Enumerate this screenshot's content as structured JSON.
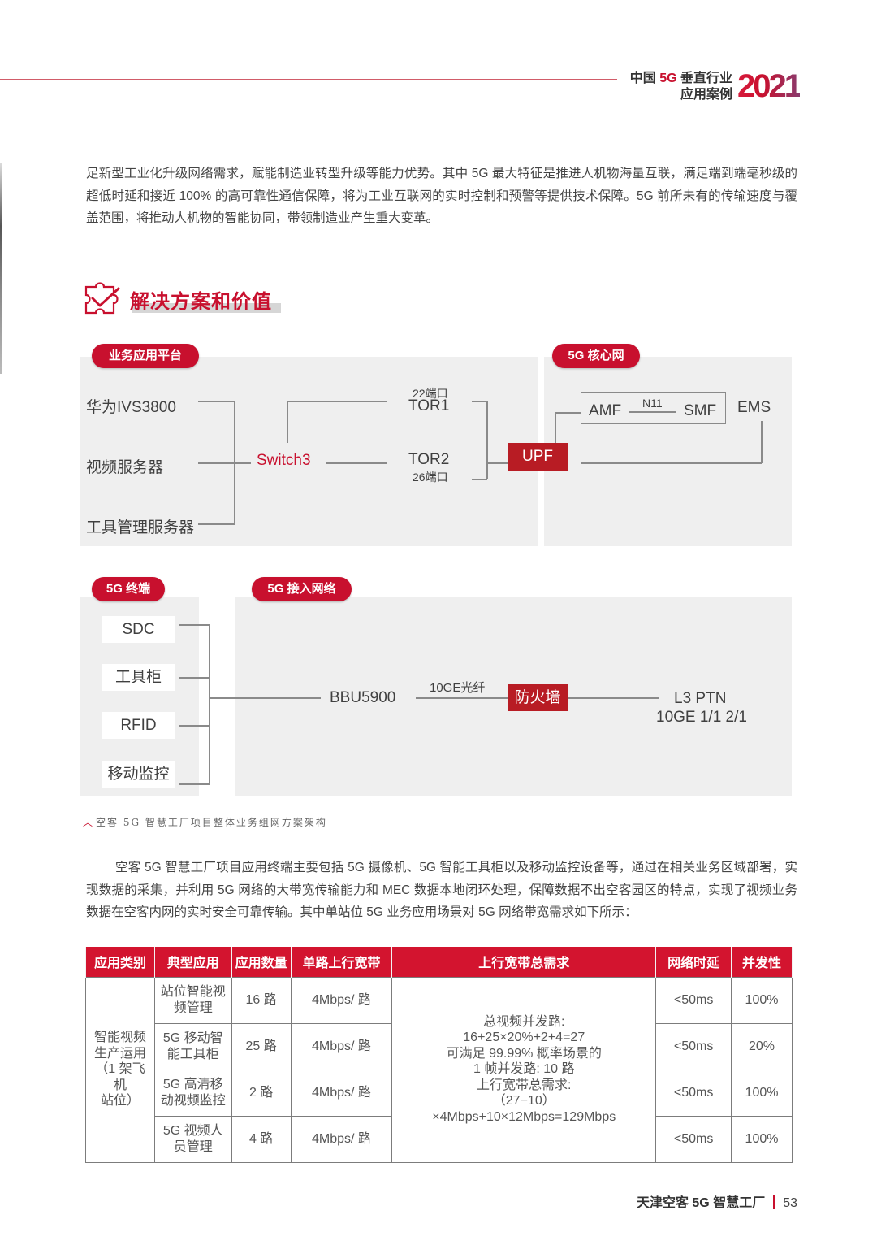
{
  "header": {
    "title_line1_prefix": "中国 ",
    "title_line1_accent": "5G",
    "title_line1_suffix": " 垂直行业",
    "title_line2": "应用案例",
    "year": "2021"
  },
  "intro_paragraph": "足新型工业化升级网络需求，赋能制造业转型升级等能力优势。其中 5G 最大特征是推进人机物海量互联，满足端到端毫秒级的超低时延和接近 100% 的高可靠性通信保障，将为工业互联网的实时控制和预警等提供技术保障。5G 前所未有的传输速度与覆盖范围，将推动人机物的智能协同，带领制造业产生重大变革。",
  "section": {
    "icon": "puzzle-check-icon",
    "title": "解决方案和价值"
  },
  "diagram": {
    "business_platform": {
      "label": "业务应用平台",
      "servers": [
        "华为IVS3800",
        "视频服务器",
        "工具管理服务器"
      ],
      "switch": "Switch3",
      "tor1": {
        "port": "22端口",
        "name": "TOR1"
      },
      "tor2": {
        "port": "26端口",
        "name": "TOR2"
      }
    },
    "core_network": {
      "label": "5G 核心网",
      "upf": "UPF",
      "amf": "AMF",
      "n11": "N11",
      "smf": "SMF",
      "ems": "EMS"
    },
    "terminals": {
      "label": "5G 终端",
      "items": [
        "SDC",
        "工具柜",
        "RFID",
        "移动监控"
      ]
    },
    "access_network": {
      "label": "5G 接入网络",
      "bbu": "BBU5900",
      "link_label": "10GE光纤",
      "firewall": "防火墙",
      "ptn_line1": "L3 PTN",
      "ptn_line2": "10GE 1/1 2/1"
    }
  },
  "caption": {
    "icon": "chevron-up-icon",
    "text": "空客 5G 智慧工厂项目整体业务组网方案架构"
  },
  "body_paragraph": "空客 5G 智慧工厂项目应用终端主要包括 5G 摄像机、5G 智能工具柜以及移动监控设备等，通过在相关业务区域部署，实现数据的采集，并利用 5G 网络的大带宽传输能力和 MEC 数据本地闭环处理，保障数据不出空客园区的特点，实现了视频业务数据在空客内网的实时安全可靠传输。其中单站位 5G 业务应用场景对 5G 网络带宽需求如下所示：",
  "table": {
    "headers": [
      "应用类别",
      "典型应用",
      "应用数量",
      "单路上行宽带",
      "上行宽带总需求",
      "网络时延",
      "并发性"
    ],
    "category": [
      "智能视频",
      "生产运用",
      "（1 架飞机",
      "站位）"
    ],
    "rows": [
      {
        "app": [
          "站位智能视",
          "频管理"
        ],
        "count": "16 路",
        "bandwidth": "4Mbps/ 路",
        "latency": "<50ms",
        "concurrency": "100%"
      },
      {
        "app": [
          "5G 移动智",
          "能工具柜"
        ],
        "count": "25 路",
        "bandwidth": "4Mbps/ 路",
        "latency": "<50ms",
        "concurrency": "20%"
      },
      {
        "app": [
          "5G 高清移",
          "动视频监控"
        ],
        "count": "2 路",
        "bandwidth": "4Mbps/ 路",
        "latency": "<50ms",
        "concurrency": "100%"
      },
      {
        "app": [
          "5G 视频人",
          "员管理"
        ],
        "count": "4 路",
        "bandwidth": "4Mbps/ 路",
        "latency": "<50ms",
        "concurrency": "100%"
      }
    ],
    "total_requirement": [
      "总视频并发路:",
      "16+25×20%+2+4=27",
      "可满足 99.99% 概率场景的",
      "1 帧并发路: 10 路",
      "上行宽带总需求:",
      "（27−10）",
      "×4Mbps+10×12Mbps=129Mbps"
    ]
  },
  "footer": {
    "title": "天津空客 5G 智慧工厂",
    "page_number": "53"
  },
  "colors": {
    "brand_red": "#c8102e",
    "table_header_red": "#d3142f",
    "panel_gray": "#efefef",
    "box_red": "#b81c24"
  }
}
